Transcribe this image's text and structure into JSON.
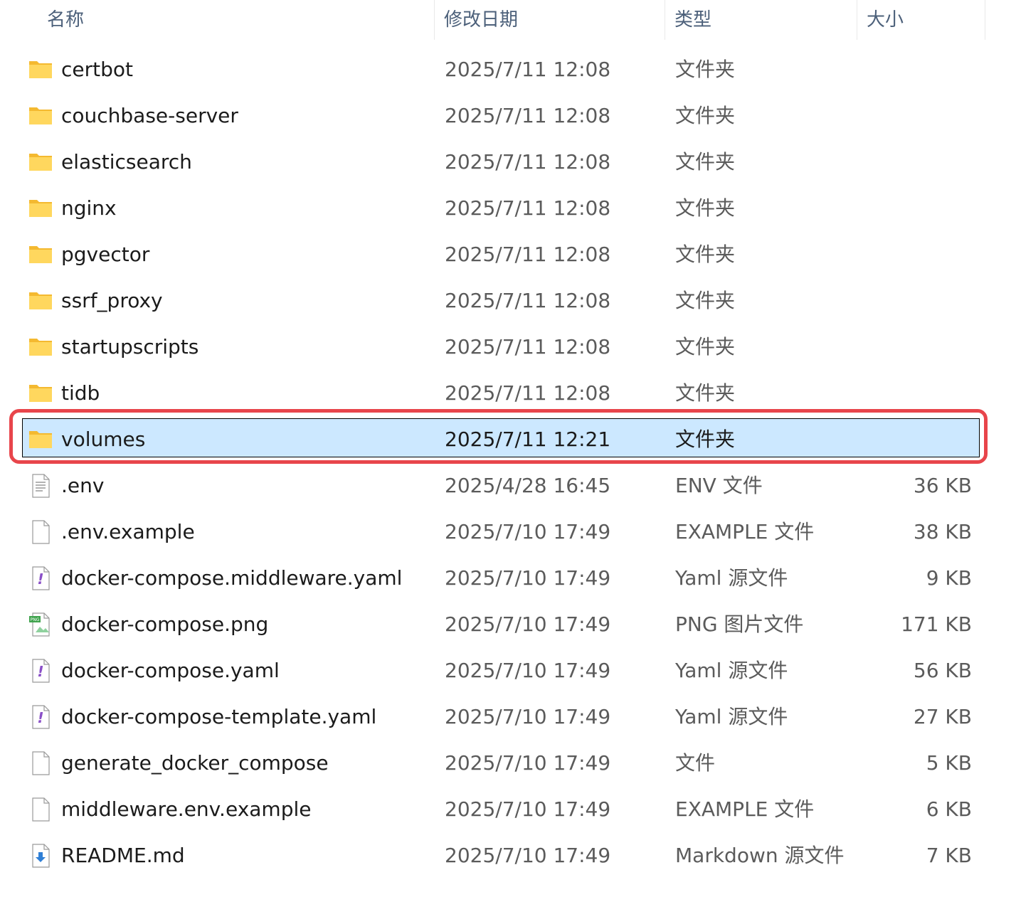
{
  "columns": {
    "name": "名称",
    "date": "修改日期",
    "type": "类型",
    "size": "大小"
  },
  "rows": [
    {
      "name": "certbot",
      "date": "2025/7/11 12:08",
      "type": "文件夹",
      "size": "",
      "icon": "folder-icon"
    },
    {
      "name": "couchbase-server",
      "date": "2025/7/11 12:08",
      "type": "文件夹",
      "size": "",
      "icon": "folder-icon"
    },
    {
      "name": "elasticsearch",
      "date": "2025/7/11 12:08",
      "type": "文件夹",
      "size": "",
      "icon": "folder-icon"
    },
    {
      "name": "nginx",
      "date": "2025/7/11 12:08",
      "type": "文件夹",
      "size": "",
      "icon": "folder-icon"
    },
    {
      "name": "pgvector",
      "date": "2025/7/11 12:08",
      "type": "文件夹",
      "size": "",
      "icon": "folder-icon"
    },
    {
      "name": "ssrf_proxy",
      "date": "2025/7/11 12:08",
      "type": "文件夹",
      "size": "",
      "icon": "folder-icon"
    },
    {
      "name": "startupscripts",
      "date": "2025/7/11 12:08",
      "type": "文件夹",
      "size": "",
      "icon": "folder-icon"
    },
    {
      "name": "tidb",
      "date": "2025/7/11 12:08",
      "type": "文件夹",
      "size": "",
      "icon": "folder-icon"
    },
    {
      "name": "volumes",
      "date": "2025/7/11 12:21",
      "type": "文件夹",
      "size": "",
      "icon": "folder-icon",
      "selected": true
    },
    {
      "name": ".env",
      "date": "2025/4/28 16:45",
      "type": "ENV 文件",
      "size": "36 KB",
      "icon": "text-file-icon"
    },
    {
      "name": ".env.example",
      "date": "2025/7/10 17:49",
      "type": "EXAMPLE 文件",
      "size": "38 KB",
      "icon": "blank-file-icon"
    },
    {
      "name": "docker-compose.middleware.yaml",
      "date": "2025/7/10 17:49",
      "type": "Yaml 源文件",
      "size": "9 KB",
      "icon": "yaml-file-icon"
    },
    {
      "name": "docker-compose.png",
      "date": "2025/7/10 17:49",
      "type": "PNG 图片文件",
      "size": "171 KB",
      "icon": "png-file-icon"
    },
    {
      "name": "docker-compose.yaml",
      "date": "2025/7/10 17:49",
      "type": "Yaml 源文件",
      "size": "56 KB",
      "icon": "yaml-file-icon"
    },
    {
      "name": "docker-compose-template.yaml",
      "date": "2025/7/10 17:49",
      "type": "Yaml 源文件",
      "size": "27 KB",
      "icon": "yaml-file-icon"
    },
    {
      "name": "generate_docker_compose",
      "date": "2025/7/10 17:49",
      "type": "文件",
      "size": "5 KB",
      "icon": "blank-file-icon"
    },
    {
      "name": "middleware.env.example",
      "date": "2025/7/10 17:49",
      "type": "EXAMPLE 文件",
      "size": "6 KB",
      "icon": "blank-file-icon"
    },
    {
      "name": "README.md",
      "date": "2025/7/10 17:49",
      "type": "Markdown 源文件",
      "size": "7 KB",
      "icon": "markdown-file-icon"
    }
  ],
  "colors": {
    "selection_bg": "#cce8ff",
    "highlight_border": "#e8454b",
    "folder_yellow": "#ffc83d"
  }
}
